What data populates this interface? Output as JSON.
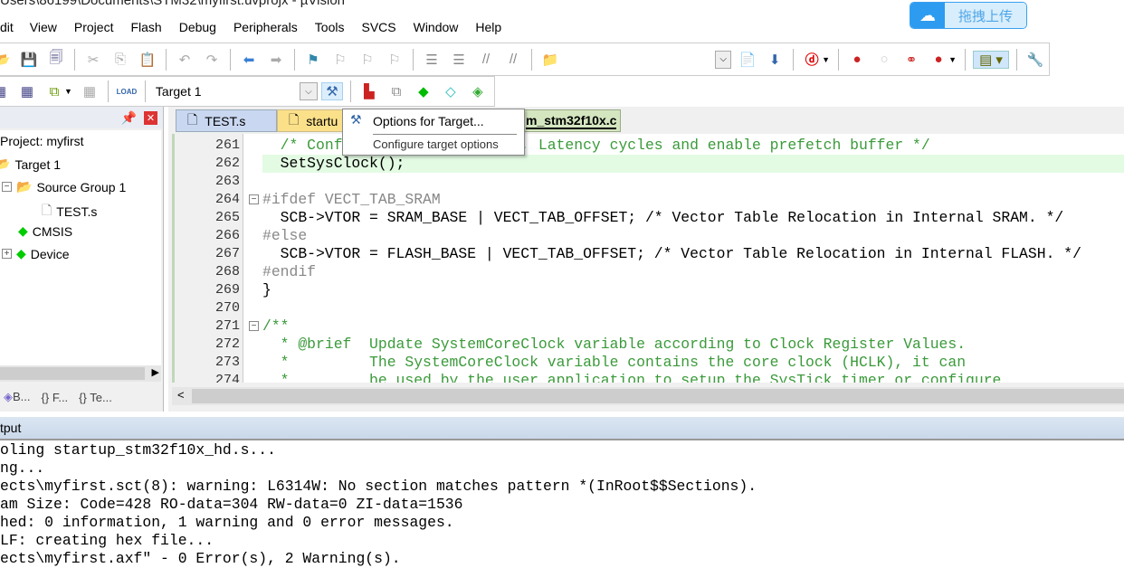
{
  "window": {
    "title": "Users\\86199\\Documents\\STM32\\myfirst.uvprojx - µVision"
  },
  "baidu": {
    "icon": "cloud-icon",
    "label": "拖拽上传"
  },
  "menu": [
    "dit",
    "View",
    "Project",
    "Flash",
    "Debug",
    "Peripherals",
    "Tools",
    "SVCS",
    "Window",
    "Help"
  ],
  "toolbar2": {
    "target": "Target 1",
    "load": "LOAD"
  },
  "tooltip": {
    "title": "Options for Target...",
    "desc": "Configure target options"
  },
  "project": {
    "items": [
      "Project: myfirst",
      "Target 1",
      "Source Group 1",
      "TEST.s",
      "CMSIS",
      "Device"
    ],
    "tabs": [
      "B...",
      "F...",
      "Te..."
    ]
  },
  "editor": {
    "tabs": [
      "TEST.s",
      "startu",
      "m_stm32f10x.c"
    ],
    "lines": [
      {
        "n": "261",
        "t": "  /* Configure Flash prefetch, Latency cycles and enable prefetch buffer */",
        "c": "cm"
      },
      {
        "n": "262",
        "t": "  SetSysClock();",
        "c": ""
      },
      {
        "n": "263",
        "t": "",
        "c": ""
      },
      {
        "n": "264",
        "t": "#ifdef VECT_TAB_SRAM",
        "c": "pp"
      },
      {
        "n": "265",
        "t": "  SCB->VTOR = SRAM_BASE | VECT_TAB_OFFSET; /* Vector Table Relocation in Internal SRAM. */",
        "c": ""
      },
      {
        "n": "266",
        "t": "#else",
        "c": "pp"
      },
      {
        "n": "267",
        "t": "  SCB->VTOR = FLASH_BASE | VECT_TAB_OFFSET; /* Vector Table Relocation in Internal FLASH. */",
        "c": ""
      },
      {
        "n": "268",
        "t": "#endif",
        "c": "pp"
      },
      {
        "n": "269",
        "t": "}",
        "c": ""
      },
      {
        "n": "270",
        "t": "",
        "c": ""
      },
      {
        "n": "271",
        "t": "/**",
        "c": "cm"
      },
      {
        "n": "272",
        "t": "  * @brief  Update SystemCoreClock variable according to Clock Register Values.",
        "c": "cm"
      },
      {
        "n": "273",
        "t": "  *         The SystemCoreClock variable contains the core clock (HCLK), it can",
        "c": "cm"
      },
      {
        "n": "274",
        "t": "  *         be used by the user application to setup the SysTick timer or configure",
        "c": "cm"
      }
    ]
  },
  "output": {
    "title": "tput",
    "lines": [
      "oling startup_stm32f10x_hd.s...",
      "ng...",
      "ects\\myfirst.sct(8): warning: L6314W: No section matches pattern *(InRoot$$Sections).",
      "am Size: Code=428 RO-data=304 RW-data=0 ZI-data=1536",
      "hed: 0 information, 1 warning and 0 error messages.",
      "LF: creating hex file...",
      "ects\\myfirst.axf\" - 0 Error(s), 2 Warning(s)."
    ]
  }
}
